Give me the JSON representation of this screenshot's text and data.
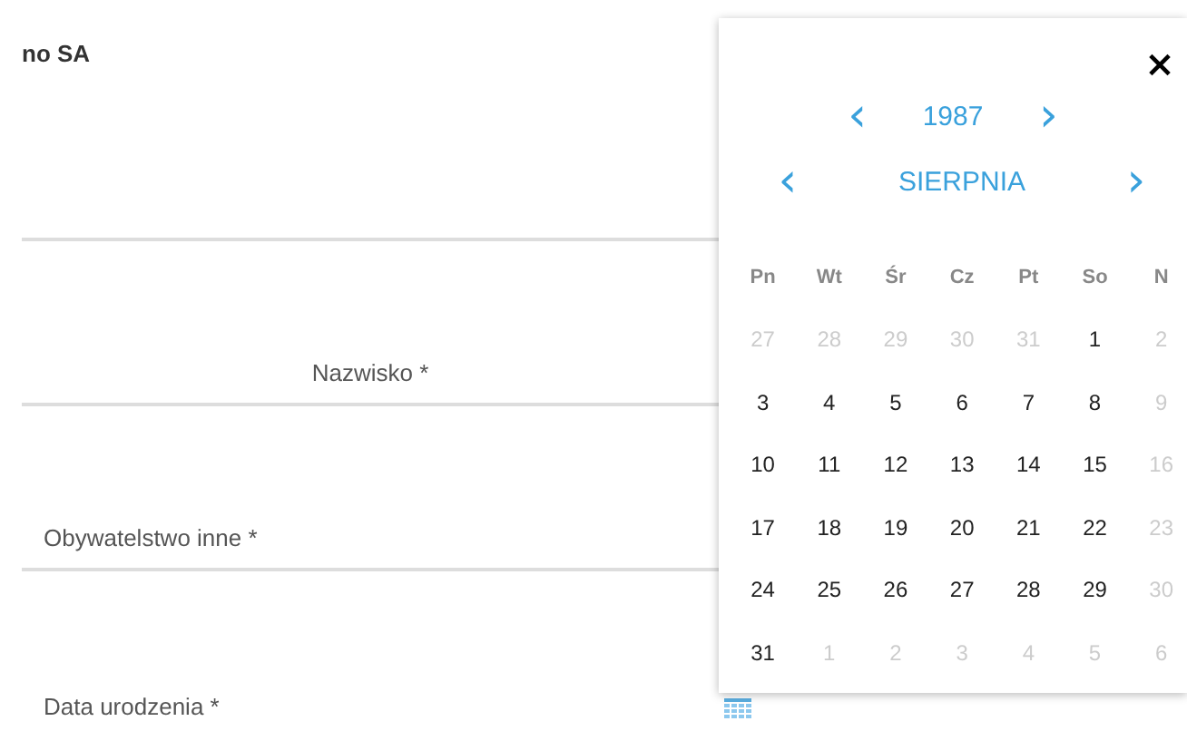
{
  "form": {
    "title": "no SA",
    "fields": [
      {
        "kind": "centered",
        "label": "Nazwisko *"
      },
      {
        "kind": "left",
        "label": "Obywatelstwo inne *"
      },
      {
        "kind": "date",
        "label": "Data urodzenia *"
      }
    ]
  },
  "datepicker": {
    "close": "×",
    "year": "1987",
    "month": "SIERPNIA",
    "prev": "‹",
    "next": "›",
    "weekdays": [
      "Pn",
      "Wt",
      "Śr",
      "Cz",
      "Pt",
      "So",
      "N"
    ],
    "days": [
      {
        "label": "27",
        "disabled": true
      },
      {
        "label": "28",
        "disabled": true
      },
      {
        "label": "29",
        "disabled": true
      },
      {
        "label": "30",
        "disabled": true
      },
      {
        "label": "31",
        "disabled": true
      },
      {
        "label": "1",
        "disabled": false
      },
      {
        "label": "2",
        "disabled": true
      },
      {
        "label": "3",
        "disabled": false
      },
      {
        "label": "4",
        "disabled": false
      },
      {
        "label": "5",
        "disabled": false
      },
      {
        "label": "6",
        "disabled": false
      },
      {
        "label": "7",
        "disabled": false
      },
      {
        "label": "8",
        "disabled": false
      },
      {
        "label": "9",
        "disabled": true
      },
      {
        "label": "10",
        "disabled": false
      },
      {
        "label": "11",
        "disabled": false
      },
      {
        "label": "12",
        "disabled": false
      },
      {
        "label": "13",
        "disabled": false
      },
      {
        "label": "14",
        "disabled": false
      },
      {
        "label": "15",
        "disabled": false
      },
      {
        "label": "16",
        "disabled": true
      },
      {
        "label": "17",
        "disabled": false
      },
      {
        "label": "18",
        "disabled": false
      },
      {
        "label": "19",
        "disabled": false
      },
      {
        "label": "20",
        "disabled": false
      },
      {
        "label": "21",
        "disabled": false
      },
      {
        "label": "22",
        "disabled": false
      },
      {
        "label": "23",
        "disabled": true
      },
      {
        "label": "24",
        "disabled": false
      },
      {
        "label": "25",
        "disabled": false
      },
      {
        "label": "26",
        "disabled": false
      },
      {
        "label": "27",
        "disabled": false
      },
      {
        "label": "28",
        "disabled": false
      },
      {
        "label": "29",
        "disabled": false
      },
      {
        "label": "30",
        "disabled": true
      },
      {
        "label": "31",
        "disabled": false
      },
      {
        "label": "1",
        "disabled": true
      },
      {
        "label": "2",
        "disabled": true
      },
      {
        "label": "3",
        "disabled": true
      },
      {
        "label": "4",
        "disabled": true
      },
      {
        "label": "5",
        "disabled": true
      },
      {
        "label": "6",
        "disabled": true
      }
    ]
  }
}
